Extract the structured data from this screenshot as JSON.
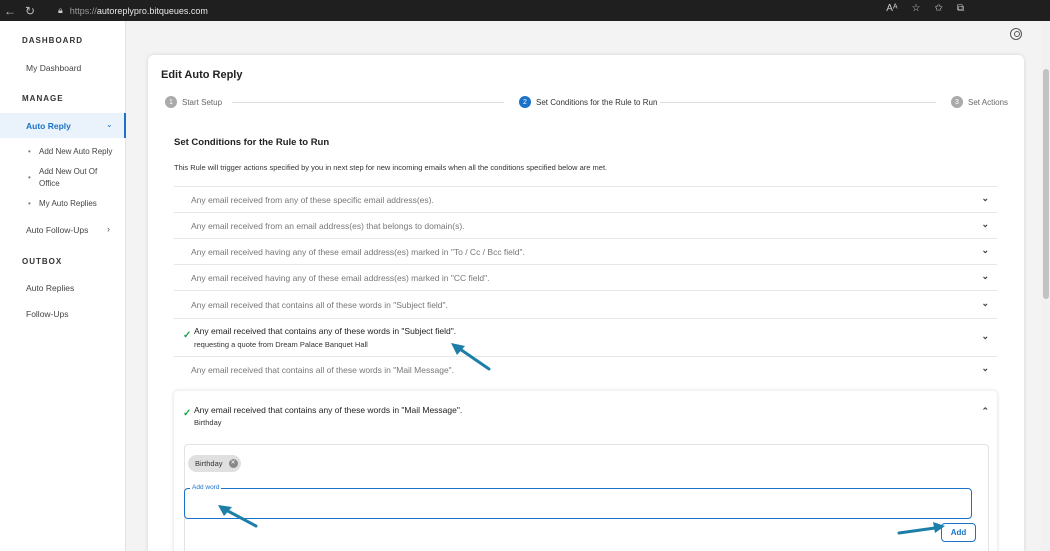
{
  "browser": {
    "url_protocol": "https://",
    "url_host": "autoreplypro.bitqueues.com"
  },
  "sidebar": {
    "dashboard_title": "DASHBOARD",
    "my_dashboard": "My Dashboard",
    "manage_title": "MANAGE",
    "auto_reply": "Auto Reply",
    "sub_items": [
      "Add New Auto Reply",
      "Add New Out Of Office",
      "My Auto Replies"
    ],
    "auto_followups": "Auto Follow-Ups",
    "outbox_title": "OUTBOX",
    "outbox_items": [
      "Auto Replies",
      "Follow-Ups"
    ]
  },
  "card": {
    "title": "Edit Auto Reply",
    "steps": [
      {
        "num": "1",
        "label": "Start Setup"
      },
      {
        "num": "2",
        "label": "Set Conditions for the Rule to Run"
      },
      {
        "num": "3",
        "label": "Set Actions"
      }
    ],
    "section_heading": "Set Conditions for the Rule to Run",
    "description": "This Rule will trigger actions specified by you in next step for new incoming emails when all the conditions specified below are met."
  },
  "conditions": [
    {
      "text": "Any email received from any of these specific email address(es)."
    },
    {
      "text": "Any email received from an email address(es) that belongs to domain(s)."
    },
    {
      "text": "Any email received having any of these email address(es) marked in \"To / Cc / Bcc field\"."
    },
    {
      "text": "Any email received having any of these email address(es) marked in \"CC field\"."
    },
    {
      "text": "Any email received that contains all of these words in \"Subject field\"."
    },
    {
      "text": "Any email received that contains any of these words in \"Subject field\".",
      "sub": "requesting a quote from Dream Palace Banquet Hall"
    },
    {
      "text": "Any email received that contains all of these words in \"Mail Message\"."
    }
  ],
  "expanded_condition": {
    "text": "Any email received that contains any of these words in \"Mail Message\".",
    "sub": "Birthday",
    "chip": "Birthday",
    "field_label": "Add word",
    "field_value": "",
    "add_button": "Add"
  },
  "colors": {
    "accent": "#1a73c8",
    "check": "#1aa34a",
    "annotation_arrow": "#1d7fa8"
  }
}
